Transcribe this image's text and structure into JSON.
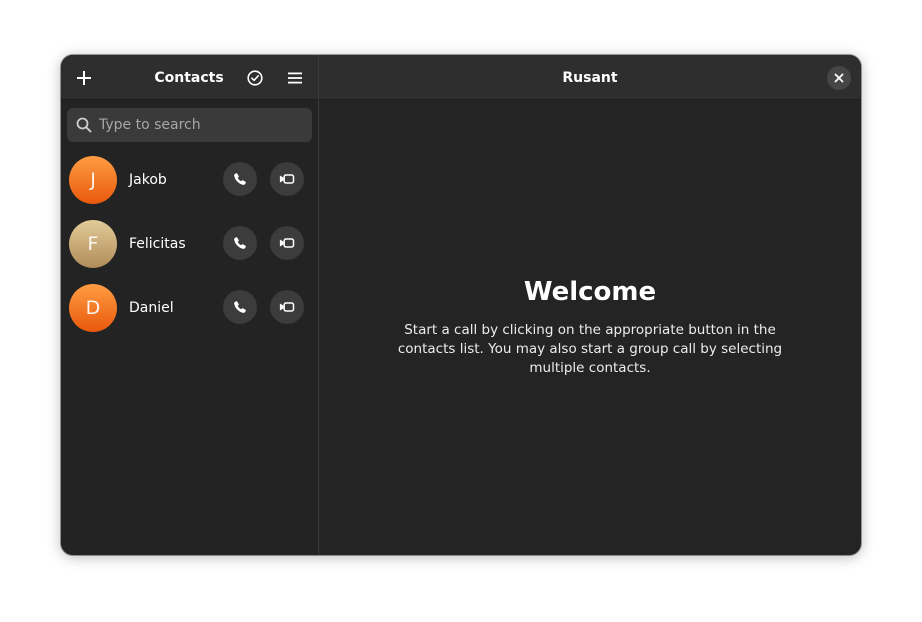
{
  "sidebar": {
    "title": "Contacts",
    "add_icon": "plus-icon",
    "select_icon": "check-circle-icon",
    "menu_icon": "hamburger-menu-icon",
    "search": {
      "placeholder": "Type to search",
      "value": ""
    },
    "contacts": [
      {
        "initial": "J",
        "name": "Jakob",
        "avatar_colors": [
          "#ff9d44",
          "#e8590c"
        ]
      },
      {
        "initial": "F",
        "name": "Felicitas",
        "avatar_colors": [
          "#e2cc98",
          "#b08c5a"
        ]
      },
      {
        "initial": "D",
        "name": "Daniel",
        "avatar_colors": [
          "#ff9d44",
          "#e8590c"
        ]
      }
    ],
    "call_icon": "phone-icon",
    "video_icon": "video-camera-icon"
  },
  "content": {
    "title": "Rusant",
    "close_icon": "close-icon",
    "welcome_title": "Welcome",
    "welcome_text": "Start a call by clicking on the appropriate button in the contacts list. You may also start a group call by selecting multiple contacts."
  },
  "colors": {
    "window_bg": "#242424",
    "header_bg": "#2e2e2e",
    "button_bg": "#3c3c3c",
    "text": "#ffffff"
  }
}
